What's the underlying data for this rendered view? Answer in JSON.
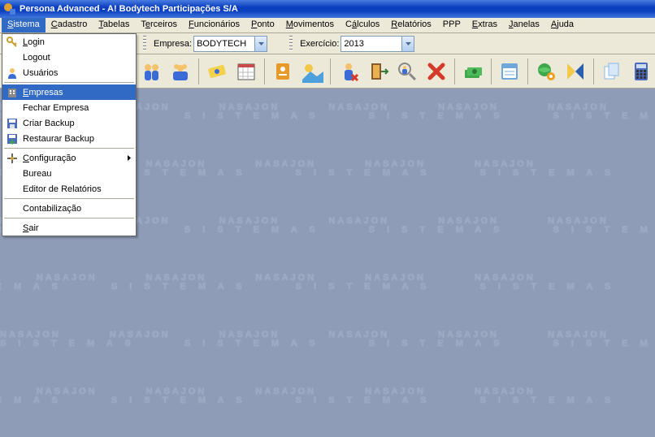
{
  "window": {
    "title": "Persona Advanced -  A! Bodytech Participações S/A"
  },
  "menubar": {
    "items": [
      {
        "label": "Sistema",
        "u": "S",
        "open": true
      },
      {
        "label": "Cadastro",
        "u": "C"
      },
      {
        "label": "Tabelas",
        "u": "T"
      },
      {
        "label": "Terceiros",
        "u": "e"
      },
      {
        "label": "Funcionários",
        "u": "F"
      },
      {
        "label": "Ponto",
        "u": "P"
      },
      {
        "label": "Movimentos",
        "u": "M"
      },
      {
        "label": "Cálculos",
        "u": "á"
      },
      {
        "label": "Relatórios",
        "u": "R"
      },
      {
        "label": "PPP",
        "u": ""
      },
      {
        "label": "Extras",
        "u": "E"
      },
      {
        "label": "Janelas",
        "u": "J"
      },
      {
        "label": "Ajuda",
        "u": "A"
      }
    ]
  },
  "combos": {
    "empresa_label": "Empresa:",
    "empresa_value": "BODYTECH",
    "exercicio_label": "Exercício:",
    "exercicio_value": "2013"
  },
  "dropdown": {
    "items": [
      {
        "label": "Login",
        "u": "L",
        "icon": "key-icon"
      },
      {
        "label": "Logout",
        "u": "",
        "icon": ""
      },
      {
        "label": "Usuários",
        "u": "",
        "icon": "user-icon"
      },
      {
        "sep": true
      },
      {
        "label": "Empresas",
        "u": "E",
        "icon": "building-icon",
        "highlight": true
      },
      {
        "label": "Fechar Empresa",
        "u": "",
        "icon": ""
      },
      {
        "label": "Criar Backup",
        "u": "",
        "icon": "save-icon"
      },
      {
        "label": "Restaurar Backup",
        "u": "",
        "icon": "restore-icon"
      },
      {
        "sep": true
      },
      {
        "label": "Configuração",
        "u": "C",
        "icon": "config-icon",
        "submenu": true
      },
      {
        "label": "Bureau",
        "u": "",
        "icon": ""
      },
      {
        "label": "Editor de Relatórios",
        "u": "",
        "icon": ""
      },
      {
        "sep": true
      },
      {
        "label": "Contabilização",
        "u": "",
        "icon": ""
      },
      {
        "sep": true
      },
      {
        "label": "Sair",
        "u": "S",
        "icon": ""
      }
    ]
  },
  "toolbar": {
    "buttons": [
      {
        "name": "people-group-1-button",
        "colors": [
          "#3b6bd6",
          "#f5c26b"
        ]
      },
      {
        "name": "people-group-2-button",
        "colors": [
          "#3b6bd6",
          "#f5c26b"
        ]
      },
      {
        "name": "ticket-button",
        "colors": [
          "#f2d24a",
          "#3b6bd6"
        ]
      },
      {
        "name": "calendar-button",
        "colors": [
          "#ffffff",
          "#c84a4a"
        ]
      },
      {
        "name": "badge-button",
        "colors": [
          "#e59a2a",
          "#ffffff"
        ]
      },
      {
        "name": "sun-mountain-button",
        "colors": [
          "#f2c84a",
          "#4ea0dc"
        ]
      },
      {
        "name": "person-red-button",
        "colors": [
          "#3b6bd6",
          "#d43a2a"
        ]
      },
      {
        "name": "door-exit-button",
        "colors": [
          "#8a5a2a",
          "#e8b050"
        ]
      },
      {
        "name": "search-person-button",
        "colors": [
          "#f5c26b",
          "#888"
        ]
      },
      {
        "name": "red-x-button",
        "colors": [
          "#d43a2a",
          "#fff"
        ]
      },
      {
        "name": "money-button",
        "colors": [
          "#3fa84a",
          "#2a7a34"
        ]
      },
      {
        "name": "form-button",
        "colors": [
          "#6fa8d8",
          "#fff"
        ]
      },
      {
        "name": "globe-gear-button",
        "colors": [
          "#3fa84a",
          "#f0a020"
        ]
      },
      {
        "name": "yellow-blue-x-button",
        "colors": [
          "#f2c84a",
          "#2a5fb0"
        ]
      },
      {
        "name": "copy-docs-button",
        "colors": [
          "#88b8e8",
          "#fff"
        ]
      },
      {
        "name": "calculator-button",
        "colors": [
          "#4a6bc0",
          "#333"
        ]
      }
    ]
  },
  "watermark": {
    "text": "NASAJON",
    "sub": "S I S T E M A S"
  }
}
